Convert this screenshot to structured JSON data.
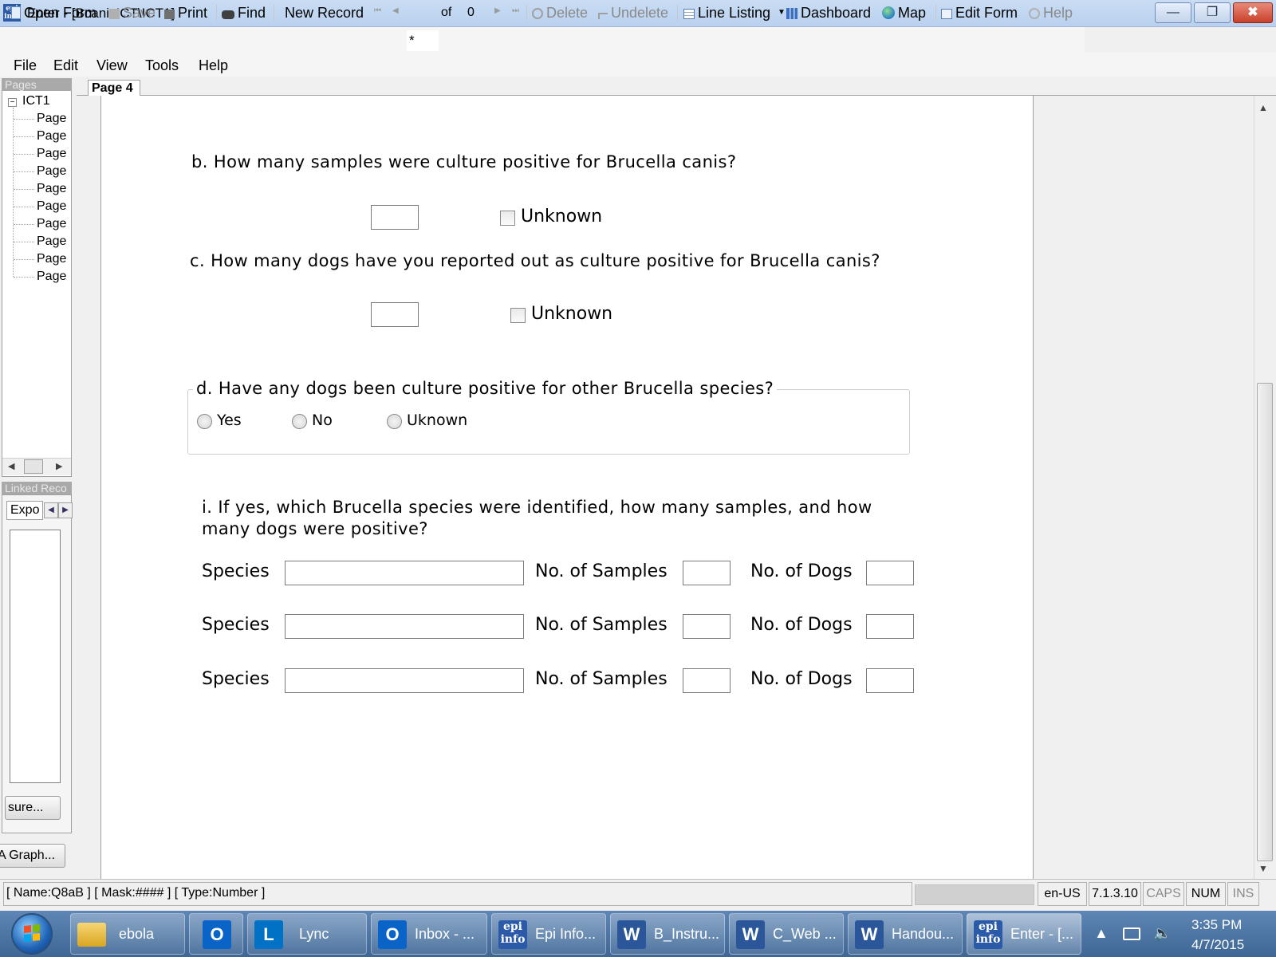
{
  "window": {
    "logo_text": "epi info",
    "title": "Enter - [BcanisICT\\ICT1]",
    "minimize_glyph": "—",
    "maximize_glyph": "❐",
    "close_glyph": "✖"
  },
  "toolbar": {
    "open_form": "Open Form",
    "save": "Save",
    "print": "Print",
    "find": "Find",
    "new_record": "New Record",
    "record_current": "*",
    "of_label": "of",
    "record_total": "0",
    "delete": "Delete",
    "undelete": "Undelete",
    "line_listing": "Line Listing",
    "dashboard": "Dashboard",
    "map": "Map",
    "edit_form": "Edit Form",
    "help": "Help"
  },
  "menu": [
    "File",
    "Edit",
    "View",
    "Tools",
    "Help"
  ],
  "pages_panel": {
    "header": "Pages",
    "root": "ICT1",
    "items": [
      "Page",
      "Page",
      "Page",
      "Page",
      "Page",
      "Page",
      "Page",
      "Page",
      "Page",
      "Page"
    ],
    "collapse_glyph": "−"
  },
  "linked_panel": {
    "header": "Linked Reco",
    "tab": "Expo",
    "button_1": "sure...",
    "button_2": "A Graph..."
  },
  "form": {
    "page_tab": "Page 4",
    "q_b": "b. How many samples were culture positive for Brucella canis?",
    "q_b_unknown": "Unknown",
    "q_c": "c. How many dogs have you reported out as culture positive for Brucella canis?",
    "q_c_unknown": "Unknown",
    "q_d": "d. Have any dogs been culture positive for other Brucella species?",
    "q_d_options": [
      "Yes",
      "No",
      "Uknown"
    ],
    "q_i_line1": "i. If yes, which Brucella species were identified, how many samples, and how",
    "q_i_line2": "many dogs were positive?",
    "species_label": "Species",
    "samples_label": "No. of Samples",
    "dogs_label": "No. of Dogs"
  },
  "status": {
    "field_info": "[ Name:Q8aB ] [ Mask:#### ] [ Type:Number ]",
    "locale": "en-US",
    "version": "7.1.3.10",
    "caps": "CAPS",
    "num": "NUM",
    "ins": "INS"
  },
  "taskbar": {
    "items": [
      {
        "label": "ebola",
        "icon": "folder-icon"
      },
      {
        "label": "",
        "icon": "outlook-icon"
      },
      {
        "label": "Lync",
        "icon": "lync-icon"
      },
      {
        "label": "Inbox - ...",
        "icon": "outlook-icon"
      },
      {
        "label": "Epi Info...",
        "icon": "epi-info-icon"
      },
      {
        "label": "B_Instru...",
        "icon": "word-icon"
      },
      {
        "label": "C_Web ...",
        "icon": "word-icon"
      },
      {
        "label": "Handou...",
        "icon": "word-icon"
      },
      {
        "label": "Enter - [...",
        "icon": "epi-info-icon"
      }
    ],
    "clock_time": "3:35 PM",
    "clock_date": "4/7/2015"
  },
  "colors": {
    "titlebar": "#c9dcf3",
    "taskbar": "#4a74a4",
    "close_button": "#c9402a",
    "word_icon": "#2b579a",
    "outlook_icon": "#0a64c8",
    "lync_icon": "#0072c6"
  }
}
